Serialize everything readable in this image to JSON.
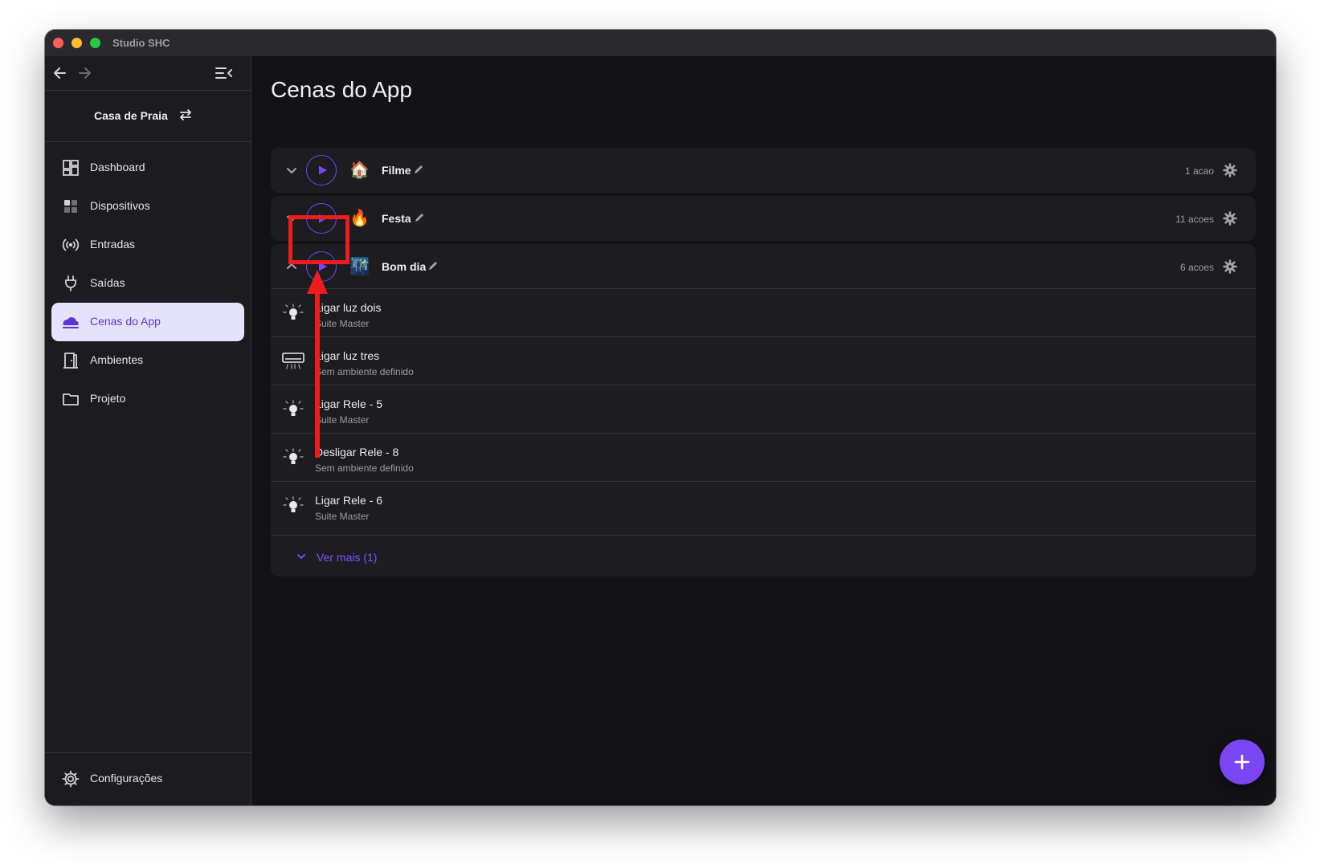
{
  "window": {
    "title": "Studio SHC"
  },
  "sidebar": {
    "house": {
      "name": "Casa de Praia"
    },
    "items": [
      {
        "label": "Dashboard",
        "icon": "dashboard-icon"
      },
      {
        "label": "Dispositivos",
        "icon": "devices-icon"
      },
      {
        "label": "Entradas",
        "icon": "inputs-broadcast-icon"
      },
      {
        "label": "Saídas",
        "icon": "outputs-plug-icon"
      },
      {
        "label": "Cenas do App",
        "icon": "scenes-cloud-icon",
        "active": true
      },
      {
        "label": "Ambientes",
        "icon": "rooms-door-icon"
      },
      {
        "label": "Projeto",
        "icon": "folder-icon"
      }
    ],
    "settings": {
      "label": "Configurações",
      "icon": "gear-icon"
    }
  },
  "main": {
    "title": "Cenas do App",
    "scenes": [
      {
        "name": "Filme",
        "emoji": "🏠",
        "count": "1 acao",
        "expanded": false
      },
      {
        "name": "Festa",
        "emoji": "🔥",
        "count": "11 acoes",
        "expanded": false
      },
      {
        "name": "Bom dia",
        "emoji": "🌃",
        "count": "6 acoes",
        "expanded": true,
        "actions": [
          {
            "title": "Ligar luz dois",
            "subtitle": "Suite Master",
            "icon": "lightbulb-icon"
          },
          {
            "title": "Ligar luz tres",
            "subtitle": "Sem ambiente definido",
            "icon": "air-conditioner-icon"
          },
          {
            "title": "Ligar Rele - 5",
            "subtitle": "Suite Master",
            "icon": "lightbulb-icon"
          },
          {
            "title": "Desligar Rele - 8",
            "subtitle": "Sem ambiente definido",
            "icon": "lightbulb-icon"
          },
          {
            "title": "Ligar Rele - 6",
            "subtitle": "Suite Master",
            "icon": "lightbulb-icon"
          }
        ],
        "more_label": "Ver mais (1)"
      }
    ]
  },
  "colors": {
    "accent": "#7a46f3",
    "background": "#131317",
    "annotation": "#ee1c1c"
  }
}
